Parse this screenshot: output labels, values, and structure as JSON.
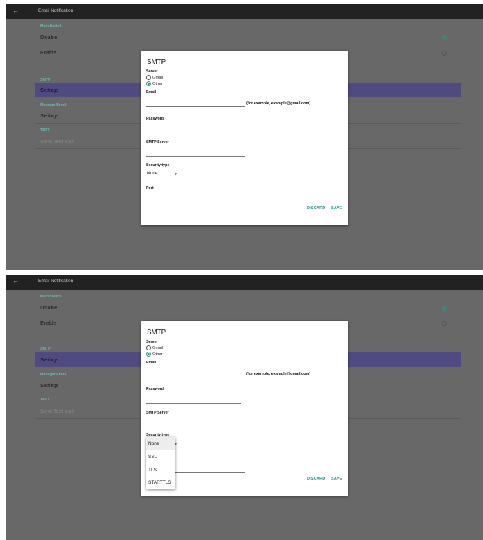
{
  "app": {
    "title": "Email Notification",
    "back_icon": "arrow-left-icon"
  },
  "main_switch": {
    "label": "Main Switch",
    "options": [
      "Disable",
      "Enable"
    ],
    "selected": "Disable"
  },
  "smtp_section": {
    "label": "SMTP",
    "item": "Settings"
  },
  "manager_section": {
    "label": "Manager Email",
    "item": "Settings"
  },
  "test_section": {
    "label": "TEST",
    "item": "Send Test Mail"
  },
  "dialog": {
    "title": "SMTP",
    "server_label": "Server",
    "server_options": [
      "Gmail",
      "Other"
    ],
    "server_selected": "Other",
    "email_label": "Email",
    "email_value": "",
    "email_hint": "(for example, example@gmail.com)",
    "password_label": "Password",
    "password_value": "",
    "smtp_server_label": "SMTP Server",
    "smtp_server_value": "",
    "security_label": "Security type",
    "security_value": "None",
    "port_label": "Port",
    "port_value": "",
    "discard": "DISCARD",
    "save": "SAVE"
  },
  "security_dropdown": {
    "options": [
      "None",
      "SSL",
      "TLS",
      "STARTTLS"
    ],
    "selected": "None"
  },
  "colors": {
    "accent": "#1f8f86",
    "selected_row": "#4f4b81",
    "topbar": "#222222",
    "background": "#686868"
  }
}
